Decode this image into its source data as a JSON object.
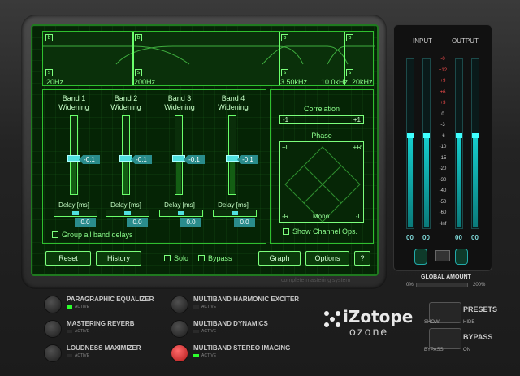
{
  "freq": {
    "labels": [
      "20Hz",
      "200Hz",
      "3.50kHz",
      "10.0kHz",
      "20kHz"
    ],
    "band_box": "b",
    "solo_box": "s"
  },
  "bands": [
    {
      "title": "Band 1\nWidening",
      "value": "-0.1",
      "delay": "0.0",
      "level": 0.5
    },
    {
      "title": "Band 2\nWidening",
      "value": "-0.1",
      "delay": "0.0",
      "level": 0.5
    },
    {
      "title": "Band 3\nWidening",
      "value": "-0.1",
      "delay": "0.0",
      "level": 0.5
    },
    {
      "title": "Band 4\nWidening",
      "value": "-0.1",
      "delay": "0.0",
      "level": 0.5
    }
  ],
  "delay_label": "Delay [ms]",
  "group_label": "Group all band delays",
  "correlation": {
    "title": "Correlation",
    "left": "-1",
    "right": "+1"
  },
  "phase": {
    "title": "Phase",
    "tl": "+L",
    "tr": "+R",
    "bl": "-R",
    "bm": "Mono",
    "br": "-L"
  },
  "show_channel_ops": "Show Channel Ops.",
  "buttons": {
    "reset": "Reset",
    "history": "History",
    "solo": "Solo",
    "bypass": "Bypass",
    "graph": "Graph",
    "options": "Options",
    "help": "?"
  },
  "meters": {
    "input_label": "INPUT",
    "output_label": "OUTPUT",
    "scale": [
      "-0",
      "+12",
      "+9",
      "+6",
      "+3",
      "0",
      "-3",
      "-6",
      "-10",
      "-15",
      "-20",
      "-30",
      "-40",
      "-50",
      "-60",
      "-Inf"
    ],
    "readouts": [
      "00",
      "00",
      "00",
      "00"
    ],
    "input_level": 0.55,
    "output_level": 0.55
  },
  "tagline": "complete mastering system",
  "global_amount": {
    "label": "GLOBAL AMOUNT",
    "min": "0%",
    "max": "200%"
  },
  "modules": [
    {
      "name": "PARAGRAPHIC EQUALIZER",
      "active": true
    },
    {
      "name": "MASTERING REVERB",
      "active": false
    },
    {
      "name": "LOUDNESS MAXIMIZER",
      "active": false
    },
    {
      "name": "MULTIBAND HARMONIC EXCITER",
      "active": false
    },
    {
      "name": "MULTIBAND DYNAMICS",
      "active": false
    },
    {
      "name": "MULTIBAND STEREO IMAGING",
      "active": true
    }
  ],
  "active_label": "ACTIVE",
  "side": {
    "presets": "PRESETS",
    "show": "SHOW",
    "hide": "HIDE",
    "bypass": "BYPASS",
    "bypass_small": "BYPASS",
    "on": "ON"
  },
  "logo": {
    "brand": "iZotope",
    "product": "ozone"
  }
}
